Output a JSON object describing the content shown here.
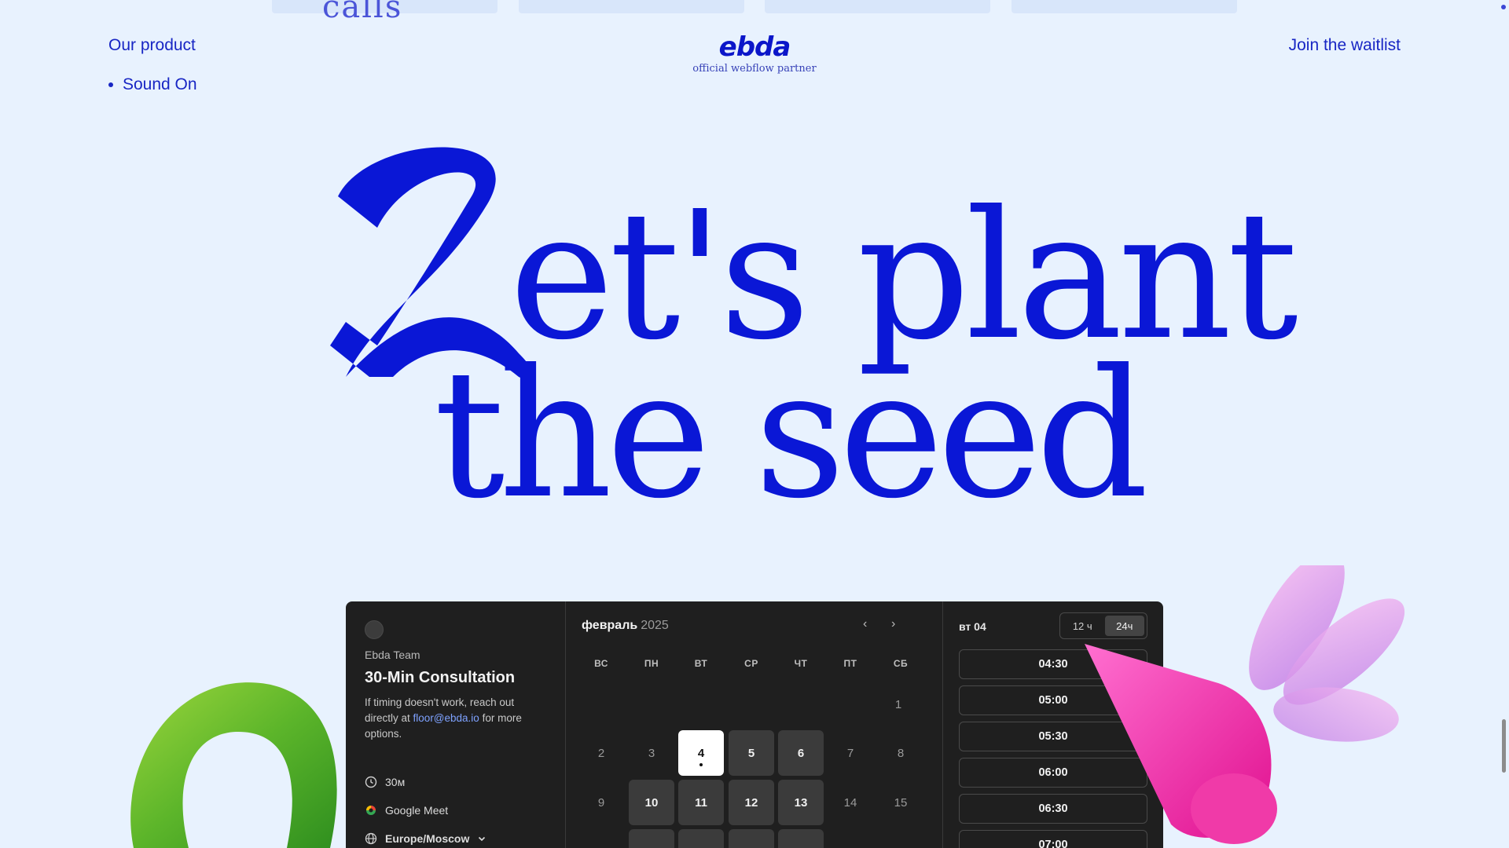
{
  "top_strip": {
    "logo_fragment": "calls"
  },
  "header": {
    "our_product": "Our product",
    "sound_on": "Sound On",
    "brand_mark": "ebda",
    "brand_sub": "official webflow partner",
    "waitlist": "Join the waitlist"
  },
  "headline": {
    "line1": "et's plant",
    "line2": "the seed",
    "script_letter": "L"
  },
  "booking": {
    "team": "Ebda Team",
    "title": "30-Min Consultation",
    "desc_prefix": "If timing doesn't work, reach out directly at",
    "email": "floor@ebda.io",
    "desc_suffix": "for more options.",
    "duration": "30м",
    "platform": "Google Meet",
    "timezone": "Europe/Moscow",
    "month": "февраль",
    "year": "2025",
    "weekdays": [
      "ВС",
      "ПН",
      "ВТ",
      "СР",
      "ЧТ",
      "ПТ",
      "СБ"
    ],
    "days": [
      "1",
      "2",
      "3",
      "4",
      "5",
      "6",
      "7",
      "8",
      "9",
      "10",
      "11",
      "12",
      "13",
      "14",
      "15"
    ],
    "selected_day_label": "вт 04",
    "format_12h": "12 ч",
    "format_24h": "24ч",
    "slots": [
      "04:30",
      "05:00",
      "05:30",
      "06:00",
      "06:30",
      "07:00"
    ]
  }
}
